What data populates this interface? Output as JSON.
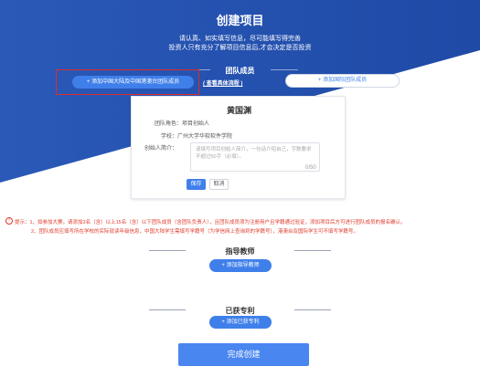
{
  "header": {
    "title": "创建项目",
    "subtitle_line1": "请认真、如实填写信息，尽可能填写得完善",
    "subtitle_line2": "投资人只有充分了解项目信息后,才会决定是否投资"
  },
  "team": {
    "section_title": "团队成员",
    "add_mainland_button": "+ 添加中国大陆及中国港澳台团队成员",
    "view_process_link": "( 查看具体流程 )",
    "add_international_button": "+ 添加国际团队成员"
  },
  "member_card": {
    "name": "黄国渊",
    "role_label": "团队角色：",
    "role_value": "项目创始人",
    "school_label": "学校：",
    "school_value": "广州大学华软软件学院",
    "intro_label": "创始人简介：",
    "intro_placeholder": "请填写项目创始人简介，一句话介绍自己，字数要求不超过50字（必填）。",
    "char_count": "0/50",
    "save_button": "保存",
    "cancel_button": "取消"
  },
  "tips": {
    "icon": "!",
    "line1": "提示：1、如参加大赛，请添加3名（含）以上15名（含）以下团队成员（含团队负责人），且团队成员须为注册用户且学籍通过验证，添加项目后方可进行团队成员的报名确认。",
    "line2": "2、团队成员应填写所在学校的实际就读年级信息，中国大陆学生需填写学籍号（为学信网上查询到的学籍号），港澳台及国际学生可不填写学籍号。"
  },
  "advisor": {
    "section_title": "指导教师",
    "add_button": "+ 添加指导教师"
  },
  "patent": {
    "section_title": "已获专利",
    "add_button": "+ 添加已获专利"
  },
  "submit_button": "完成创建",
  "colors": {
    "header_blue": "#2a59b8",
    "header_blue_dark": "#1f4aa6",
    "accent": "#3f7fea",
    "warning_red": "#e03a2a",
    "highlight_red": "#e02c2c"
  }
}
